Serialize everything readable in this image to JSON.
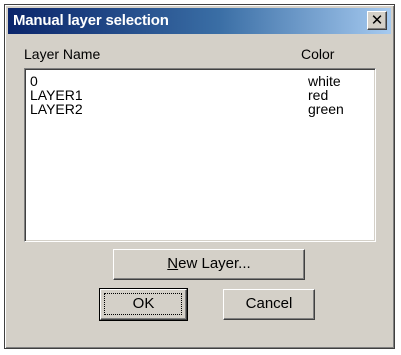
{
  "window": {
    "title": "Manual layer selection",
    "close_glyph": "✕"
  },
  "columns": {
    "name": "Layer Name",
    "color": "Color"
  },
  "layers": [
    {
      "name": "0",
      "color": "white"
    },
    {
      "name": "LAYER1",
      "color": "red"
    },
    {
      "name": "LAYER2",
      "color": "green"
    }
  ],
  "buttons": {
    "new_layer_accel": "N",
    "new_layer_rest": "ew Layer...",
    "ok_label": "OK",
    "cancel_label": "Cancel"
  },
  "colors": {
    "title_gradient_start": "#0a246a",
    "title_gradient_end": "#a6caf0",
    "face": "#d4d0c8"
  }
}
